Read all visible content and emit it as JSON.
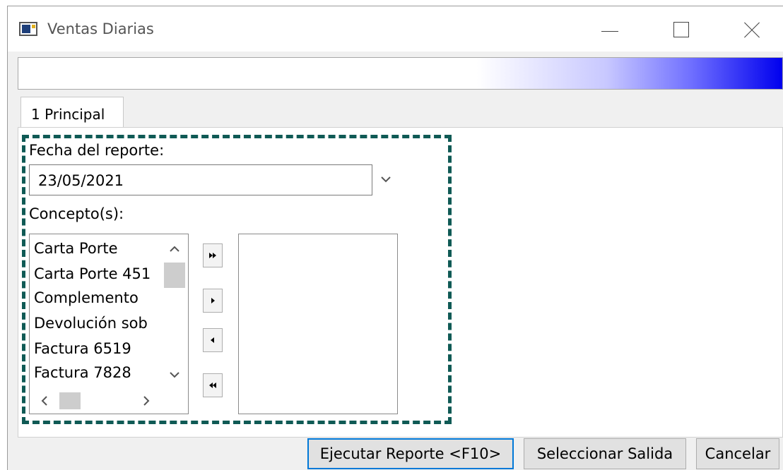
{
  "window": {
    "title": "Ventas Diarias",
    "title_icon": "app-window-icon",
    "controls": [
      "minimize-icon",
      "maximize-icon",
      "close-icon"
    ]
  },
  "banner": {
    "gradient_colors": [
      "#ffffff",
      "#0000ee"
    ]
  },
  "tabs": [
    {
      "label": "1 Principal",
      "selected": true
    }
  ],
  "form": {
    "fecha_label": "Fecha del reporte:",
    "fecha_value": "23/05/2021",
    "conceptos_label": "Concepto(s):",
    "available_items": [
      "Carta Porte",
      "Carta Porte 451",
      "Complemento",
      "Devolución sob",
      "Factura 6519",
      "Factura 7828"
    ],
    "selected_items": [],
    "move_buttons": [
      "move-all-right-icon",
      "move-right-icon",
      "move-left-icon",
      "move-all-left-icon"
    ]
  },
  "highlight_color": "#0f5a55",
  "buttons": {
    "ejecutar": "Ejecutar Reporte <F10>",
    "seleccionar": "Seleccionar Salida",
    "cancelar": "Cancelar"
  }
}
